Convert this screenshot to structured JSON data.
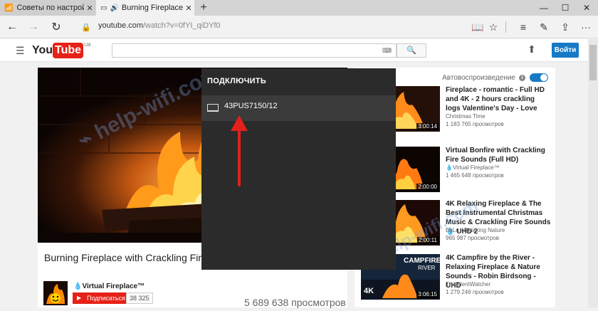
{
  "browser": {
    "tabs": [
      {
        "title": "Советы по настройке Wi-F",
        "active": false
      },
      {
        "title": "Burning Fireplace w",
        "active": true
      }
    ],
    "url_host": "youtube.com",
    "url_path": "/watch?v=0fYI_qiDYf0",
    "icons": [
      "back-icon",
      "forward-icon",
      "refresh-icon",
      "lock-icon",
      "reading-view-icon",
      "favorite-star-icon",
      "hub-icon",
      "web-note-icon",
      "share-icon",
      "more-icon"
    ]
  },
  "youtube": {
    "logo_you": "You",
    "logo_tube": "Tube",
    "region": "UA",
    "search_placeholder": "",
    "login_label": "Войти",
    "video": {
      "title": "Burning Fireplace with Crackling Fire Sounds (Full HD)",
      "channel": "Virtual Fireplace™",
      "subscribe_label": "Подписаться",
      "subscribers": "38 325",
      "views": "5 689 638 просмотров"
    },
    "autoplay_label": "Автовоспроизведение",
    "related": [
      {
        "title": "Fireplace - romantic - Full HD and 4K - 2 hours crackling logs Valentine's Day - Love",
        "channel": "Christmas Time",
        "views": "1 183 765 просмотров",
        "duration": "3:00:14"
      },
      {
        "title": "Virtual Bonfire with Crackling Fire Sounds (Full HD)",
        "channel": "Virtual Fireplace™",
        "views": "1 465 648 просмотров",
        "duration": "2:00:00"
      },
      {
        "title": "4K Relaxing Fireplace & The Best Instrumental Christmas Music & Crackling Fire Sounds 💧 UHD 2",
        "channel": "BaLu - Relaxing Nature",
        "views": "965 987 просмотров",
        "duration": "2:00:11"
      },
      {
        "title": "4K Campfire by the River - Relaxing Fireplace & Nature Sounds - Robin Birdsong - UHD",
        "channel": "TheSilentWatcher",
        "views": "1 279 246 просмотров",
        "duration": "3:06:15"
      }
    ],
    "thumb_overlay": {
      "campfire": "CAMPFIRE",
      "river": "RIVER",
      "badge": "4K"
    }
  },
  "cast_panel": {
    "heading": "ПОДКЛЮЧИТЬ",
    "device": "43PUS7150/12"
  },
  "watermark": "help-wifi.com",
  "colors": {
    "accent": "#167ac6",
    "youtube_red": "#e62117",
    "arrow": "#e3201b"
  }
}
